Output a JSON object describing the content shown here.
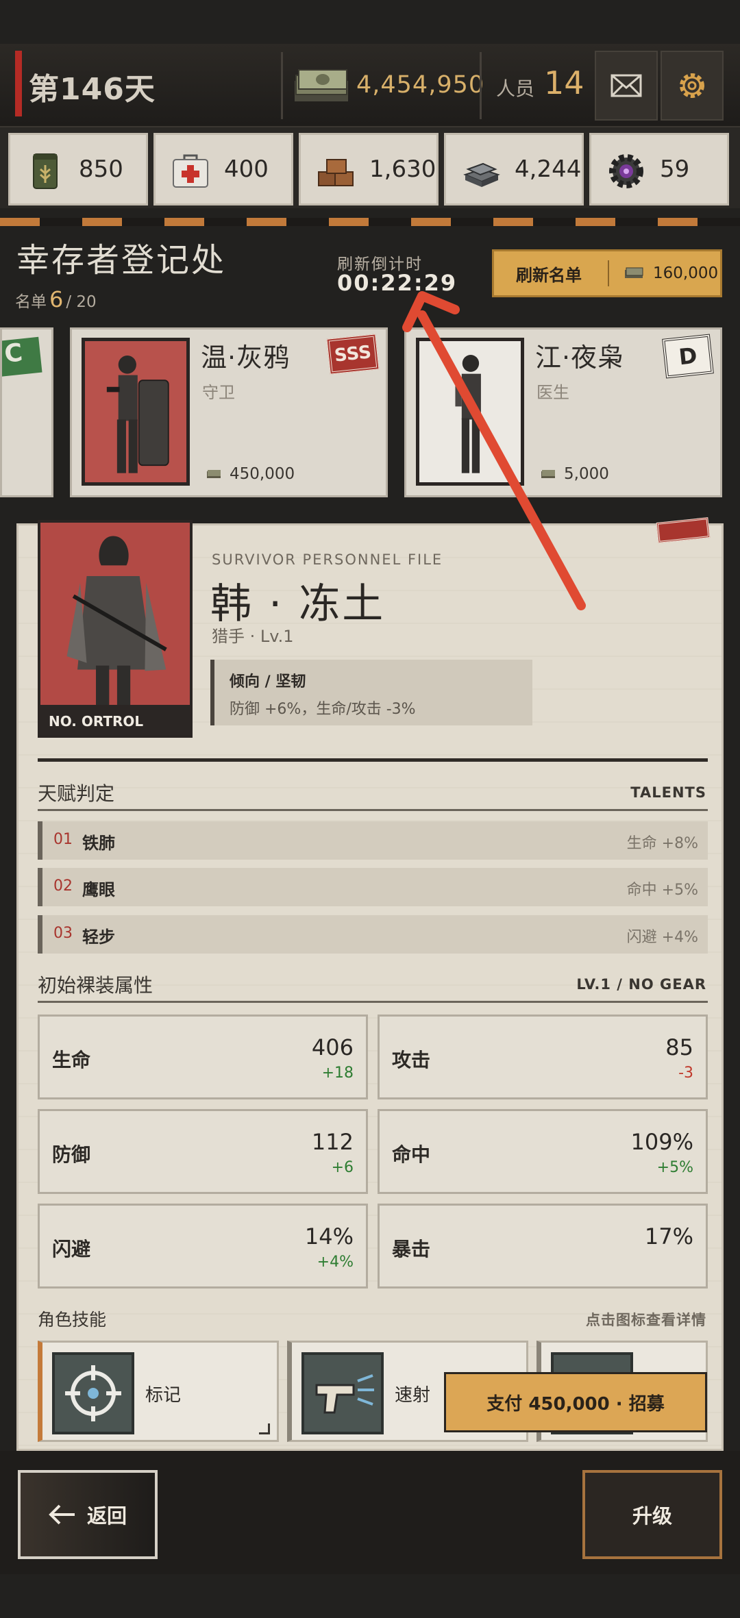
{
  "topbar": {
    "day": "第146天",
    "cash": "4,454,950",
    "staff_label": "人员",
    "staff_count": "14",
    "icons": [
      "cash-icon",
      "mail-icon",
      "settings-icon"
    ]
  },
  "resources": [
    {
      "icon": "food-can-icon",
      "value": "850"
    },
    {
      "icon": "medkit-icon",
      "value": "400"
    },
    {
      "icon": "wood-icon",
      "value": "1,630"
    },
    {
      "icon": "metal-icon",
      "value": "4,244"
    },
    {
      "icon": "gear-part-icon",
      "value": "59"
    }
  ],
  "registry": {
    "title": "幸存者登记处",
    "list_label": "名单",
    "list_current": "6",
    "list_total": "/ 20",
    "timer_label": "刷新倒计时",
    "timer_value": "00:22:29",
    "refresh_label": "刷新名单",
    "refresh_cost": "160,000"
  },
  "roster": [
    {
      "grade": "C"
    },
    {
      "name": "温·灰鸦",
      "role": "守卫",
      "price": "450,000",
      "grade": "SSS"
    },
    {
      "name": "江·夜枭",
      "role": "医生",
      "price": "5,000",
      "grade": "D"
    }
  ],
  "file": {
    "eyebrow": "SURVIVOR PERSONNEL FILE",
    "name": "韩 · 冻土",
    "class": "猎手 · Lv.1",
    "portrait_tag": "NO. ORTROL",
    "trait_title": "倾向 /   坚韧",
    "trait_desc": "防御 +6%，生命/攻击 -3%",
    "talents_title": "天赋判定",
    "talents_en": "TALENTS",
    "talents": [
      {
        "num": "01",
        "name": "铁肺",
        "effect": "生命 +8%"
      },
      {
        "num": "02",
        "name": "鹰眼",
        "effect": "命中 +5%"
      },
      {
        "num": "03",
        "name": "轻步",
        "effect": "闪避 +4%"
      }
    ],
    "stats_title": "初始裸装属性",
    "stats_en": "LV.1 / NO GEAR",
    "stats": [
      {
        "label": "生命",
        "value": "406",
        "delta": "+18"
      },
      {
        "label": "攻击",
        "value": "85",
        "delta": "-3"
      },
      {
        "label": "防御",
        "value": "112",
        "delta": "+6"
      },
      {
        "label": "命中",
        "value": "109%",
        "delta": "+5%"
      },
      {
        "label": "闪避",
        "value": "14%",
        "delta": "+4%"
      },
      {
        "label": "暴击",
        "value": "17%",
        "delta": ""
      }
    ],
    "skills_title": "角色技能",
    "skills_hint": "点击图标查看详情",
    "skills": [
      {
        "icon": "crosshair-icon",
        "name": "标记"
      },
      {
        "icon": "pistol-icon",
        "name": "速射"
      },
      {
        "icon": "skill-icon",
        "name": ""
      }
    ],
    "recruit_label": "支付 450,000 · 招募"
  },
  "bottom": {
    "back_label": "返回",
    "upgrade_label": "升级"
  },
  "colors": {
    "accent_gold": "#dca655",
    "accent_red": "#a8352e",
    "annotation_arrow": "#e04a32"
  }
}
